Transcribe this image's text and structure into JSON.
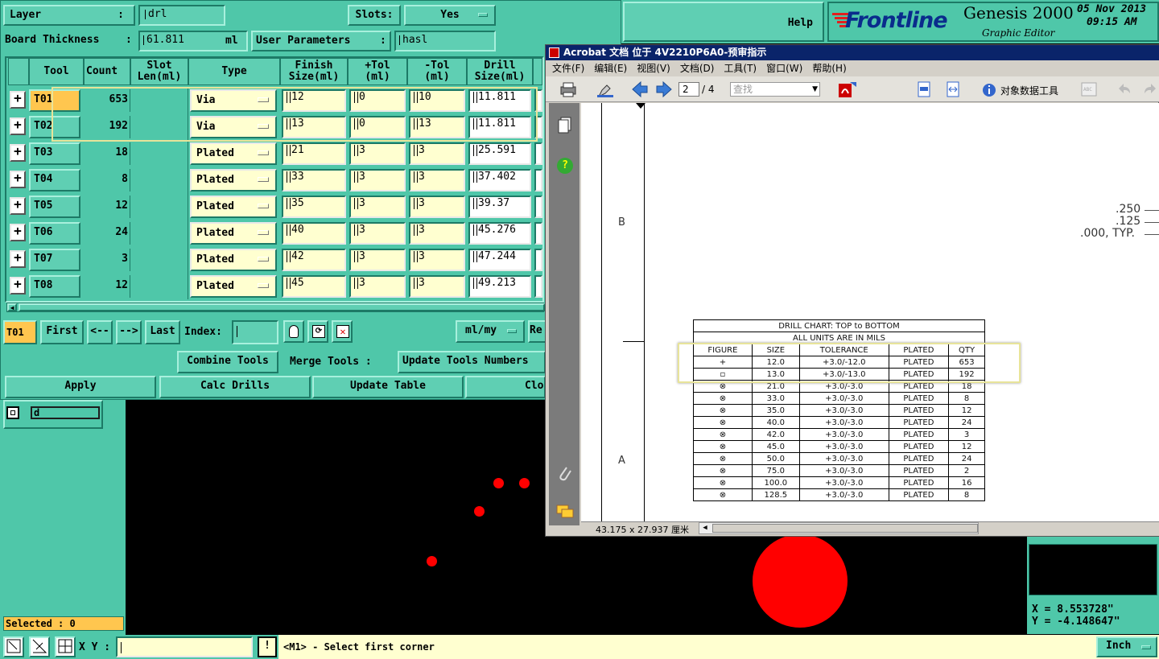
{
  "top": {
    "layer_label": "Layer",
    "layer_colon": ":",
    "layer_value": "drl",
    "slots_label": "Slots:",
    "slots_value": "Yes",
    "board_thickness_label": "Board Thickness",
    "board_thickness_colon": ":",
    "board_thickness_value": "61.811",
    "board_thickness_unit": "ml",
    "user_params_label": "User Parameters",
    "user_params_colon": ":",
    "user_params_value": "hasl",
    "help_label": "Help"
  },
  "brand": {
    "logo_text": "Frontline",
    "product": "Genesis 2000",
    "subtitle": "Graphic Editor",
    "date": "05 Nov 2013",
    "time": "09:15 AM"
  },
  "table": {
    "headers": [
      "Tool",
      "Count",
      "Slot\nLen(ml)",
      "Type",
      "Finish\nSize(ml)",
      "+Tol\n(ml)",
      "-Tol\n(ml)",
      "Drill\nSize(ml)"
    ],
    "rows": [
      {
        "tool": "T01",
        "count": "653",
        "type": "Via",
        "finish": "12",
        "ptol": "0",
        "ntol": "10",
        "drill": "11.811"
      },
      {
        "tool": "T02",
        "count": "192",
        "type": "Via",
        "finish": "13",
        "ptol": "0",
        "ntol": "13",
        "drill": "11.811"
      },
      {
        "tool": "T03",
        "count": "18",
        "type": "Plated",
        "finish": "21",
        "ptol": "3",
        "ntol": "3",
        "drill": "25.591"
      },
      {
        "tool": "T04",
        "count": "8",
        "type": "Plated",
        "finish": "33",
        "ptol": "3",
        "ntol": "3",
        "drill": "37.402"
      },
      {
        "tool": "T05",
        "count": "12",
        "type": "Plated",
        "finish": "35",
        "ptol": "3",
        "ntol": "3",
        "drill": "39.37"
      },
      {
        "tool": "T06",
        "count": "24",
        "type": "Plated",
        "finish": "40",
        "ptol": "3",
        "ntol": "3",
        "drill": "45.276"
      },
      {
        "tool": "T07",
        "count": "3",
        "type": "Plated",
        "finish": "42",
        "ptol": "3",
        "ntol": "3",
        "drill": "47.244"
      },
      {
        "tool": "T08",
        "count": "12",
        "type": "Plated",
        "finish": "45",
        "ptol": "3",
        "ntol": "3",
        "drill": "49.213"
      }
    ]
  },
  "nav": {
    "current_tool": "T01",
    "first": "First",
    "prev": "<--",
    "next": "-->",
    "last": "Last",
    "index_label": "Index:",
    "units": "ml/my",
    "re": "Re"
  },
  "actions": {
    "combine": "Combine Tools",
    "merge": "Merge Tools :",
    "update_numbers": "Update Tools Numbers",
    "apply": "Apply",
    "calc": "Calc Drills",
    "update_table": "Update Table",
    "close": "Clo"
  },
  "layer_list": {
    "item": "d"
  },
  "status": {
    "selected": "Selected : 0",
    "xy_label": "X Y :",
    "message": "<M1> - Select first corner",
    "coord_x": "X = 8.553728\"",
    "coord_y": "Y = -4.148647\"",
    "unit": "Inch"
  },
  "acrobat": {
    "title": "Acrobat 文档 位于 4V2210P6A0-预审指示",
    "menu": [
      "文件(F)",
      "编辑(E)",
      "视图(V)",
      "文档(D)",
      "工具(T)",
      "窗口(W)",
      "帮助(H)"
    ],
    "page_current": "2",
    "page_total": "/ 4",
    "search_placeholder": "查找",
    "data_tool": "对象数据工具",
    "status_size": "43.175 x 27.937 厘米",
    "zone_b": "B",
    "zone_a": "A",
    "dim_250": ".250",
    "dim_125": ".125",
    "dim_000": ".000, TYP."
  },
  "drill_chart": {
    "title": "DRILL CHART: TOP to BOTTOM",
    "subtitle": "ALL UNITS ARE IN MILS",
    "headers": [
      "FIGURE",
      "SIZE",
      "TOLERANCE",
      "PLATED",
      "QTY"
    ],
    "rows": [
      [
        "+",
        "12.0",
        "+3.0/-12.0",
        "PLATED",
        "653"
      ],
      [
        "▫",
        "13.0",
        "+3.0/-13.0",
        "PLATED",
        "192"
      ],
      [
        "⊗",
        "21.0",
        "+3.0/-3.0",
        "PLATED",
        "18"
      ],
      [
        "⊗",
        "33.0",
        "+3.0/-3.0",
        "PLATED",
        "8"
      ],
      [
        "⊗",
        "35.0",
        "+3.0/-3.0",
        "PLATED",
        "12"
      ],
      [
        "⊗",
        "40.0",
        "+3.0/-3.0",
        "PLATED",
        "24"
      ],
      [
        "⊗",
        "42.0",
        "+3.0/-3.0",
        "PLATED",
        "3"
      ],
      [
        "⊗",
        "45.0",
        "+3.0/-3.0",
        "PLATED",
        "12"
      ],
      [
        "⊗",
        "50.0",
        "+3.0/-3.0",
        "PLATED",
        "24"
      ],
      [
        "⊗",
        "75.0",
        "+3.0/-3.0",
        "PLATED",
        "2"
      ],
      [
        "⊗",
        "100.0",
        "+3.0/-3.0",
        "PLATED",
        "16"
      ],
      [
        "⊗",
        "128.5",
        "+3.0/-3.0",
        "PLATED",
        "8"
      ]
    ]
  },
  "colors": {
    "panel": "#4fc7a9",
    "highlight": "#ffc64f",
    "input": "#ffffd0",
    "pad": "#ff0000"
  }
}
